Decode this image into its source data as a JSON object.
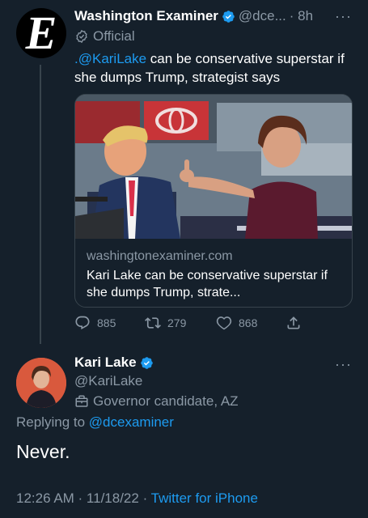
{
  "parent_tweet": {
    "author_name": "Washington Examiner",
    "handle": "@dce...",
    "time": "· 8h",
    "more": "···",
    "badge_label": "Official",
    "text_mention": ".@KariLake",
    "text_body": " can be conservative superstar if she dumps Trump, strategist says",
    "card": {
      "domain": "washingtonexaminer.com",
      "title": "Kari Lake can be conservative superstar if she dumps Trump, strate..."
    },
    "stats": {
      "replies": "885",
      "retweets": "279",
      "likes": "868"
    }
  },
  "reply_tweet": {
    "author_name": "Kari Lake",
    "handle": "@KariLake",
    "bio": "Governor candidate, AZ",
    "more": "···",
    "replying_prefix": "Replying to ",
    "replying_handle": "@dcexaminer",
    "text": "Never.",
    "timestamp": "12:26 AM · 11/18/22 · ",
    "source": "Twitter for iPhone"
  },
  "colors": {
    "background": "#15202b",
    "accent": "#1d9bf0",
    "muted": "#8b98a5",
    "border": "#38444d"
  },
  "icons": [
    "verified-badge-icon",
    "official-badge-icon",
    "reply-icon",
    "retweet-icon",
    "like-icon",
    "share-icon",
    "briefcase-icon",
    "more-icon"
  ]
}
